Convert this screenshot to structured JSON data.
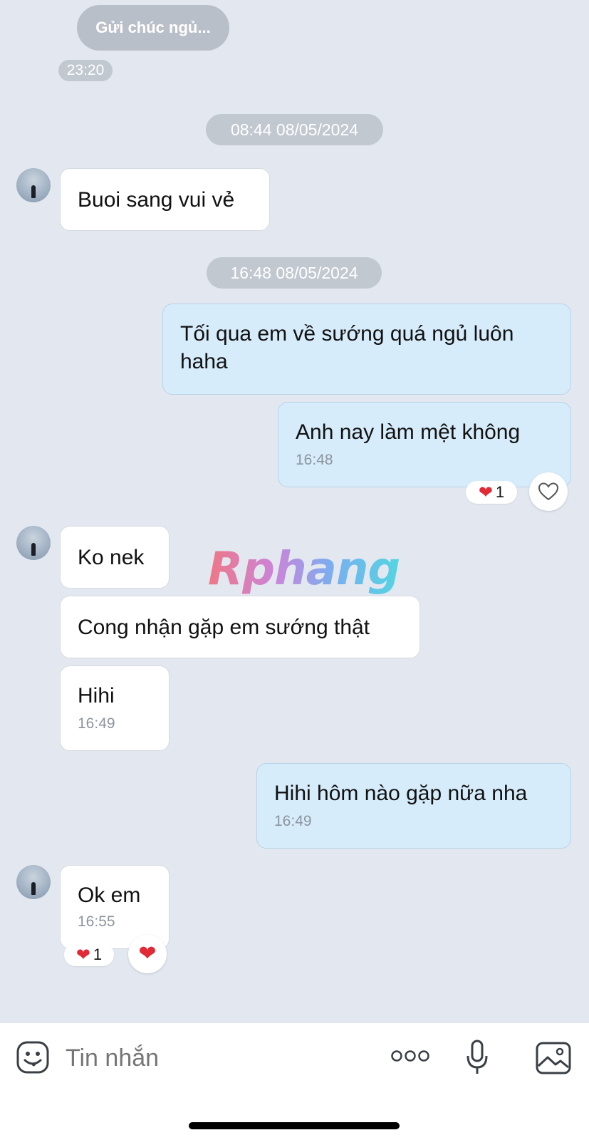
{
  "top_preview": {
    "text": "Gửi chúc ngủ...",
    "time": "23:20"
  },
  "messages": [
    {
      "stamp": "08:44 08/05/2024"
    },
    {
      "text": "Buoi sang vui vẻ"
    },
    {
      "stamp": "16:48 08/05/2024"
    },
    {
      "text": "Tối qua em về sướng quá ngủ luôn haha"
    },
    {
      "text": "Anh nay làm mệt không",
      "time": "16:48",
      "reaction_count": "1"
    },
    {
      "text": "Ko nek"
    },
    {
      "text": "Cong nhận gặp em sướng thật"
    },
    {
      "text": "Hihi",
      "time": "16:49"
    },
    {
      "text": "Hihi hôm nào gặp nữa nha",
      "time": "16:49"
    },
    {
      "text": "Ok em",
      "time": "16:55",
      "reaction_count": "1"
    }
  ],
  "watermark": "Rphang",
  "composer": {
    "placeholder": "Tin nhắn"
  },
  "icons": {
    "emoji": "emoji-icon",
    "more": "more-dots-icon",
    "mic": "microphone-icon",
    "image": "image-icon",
    "heart": "heart-icon"
  },
  "colors": {
    "background": "#e3e8f0",
    "incoming_bubble": "#ffffff",
    "outgoing_bubble": "#d7ecfb",
    "heart": "#e02a36"
  }
}
